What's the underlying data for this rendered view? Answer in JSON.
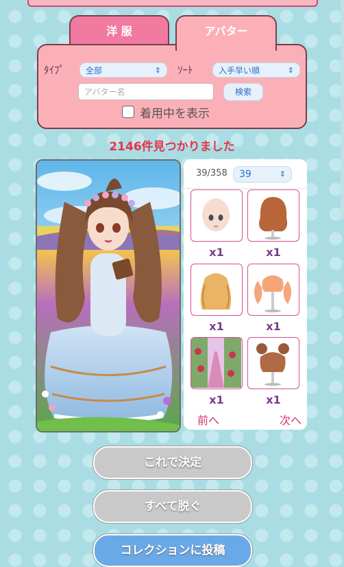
{
  "tabs": [
    {
      "label": "洋 服"
    },
    {
      "label": "アバター"
    }
  ],
  "filters": {
    "type_label": "ﾀｲﾌﾟ",
    "type_value": "全部",
    "sort_label": "ｿｰﾄ",
    "sort_value": "入手早い順",
    "name_placeholder": "アバター名",
    "search_button": "検索",
    "show_wearing_label": "着用中を表示"
  },
  "result_text": "2146件見つかりました",
  "grid": {
    "page_count": "39/358",
    "page_value": "39",
    "items": [
      {
        "icon": "bald-head-base-icon",
        "qty": "x1"
      },
      {
        "icon": "short-auburn-wig-icon",
        "qty": "x1"
      },
      {
        "icon": "long-blonde-curly-wig-icon",
        "qty": "x1"
      },
      {
        "icon": "peach-twin-curl-wig-icon",
        "qty": "x1"
      },
      {
        "icon": "rose-garden-background-icon",
        "qty": "x1"
      },
      {
        "icon": "brown-bun-wig-icon",
        "qty": "x1"
      }
    ],
    "prev_label": "前へ",
    "next_label": "次へ"
  },
  "buttons": {
    "decide": "これで決定",
    "undress": "すべて脱ぐ",
    "collection": "コレクションに投稿"
  },
  "colors": {
    "accent_pink": "#f07aa0",
    "panel_pink": "#fbb0b8",
    "result_red": "#e8334a",
    "select_blue": "#2c6fc4"
  }
}
